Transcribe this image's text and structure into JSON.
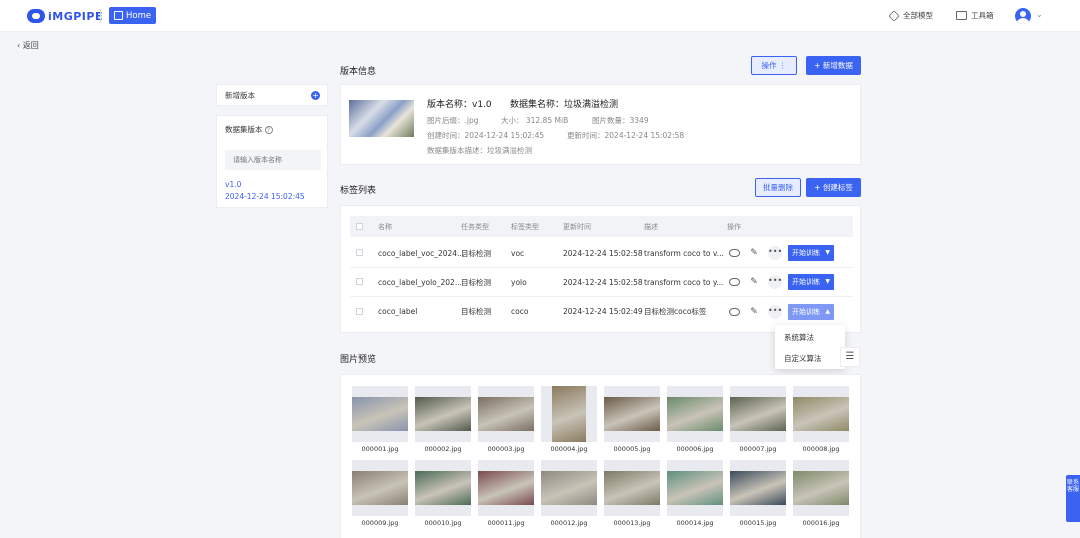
{
  "topbar": {
    "logo_text": "iMGPIPE",
    "home_label": "Home",
    "models_label": "全部模型",
    "toolbox_label": "工具箱"
  },
  "back_label": "返回",
  "sidebar": {
    "new_version_label": "新增版本",
    "versions_title": "数据集版本",
    "search_placeholder": "请输入版本名称",
    "versions": [
      {
        "name": "v1.0",
        "time": "2024-12-24 15:02:45"
      }
    ]
  },
  "version_info": {
    "section_title": "版本信息",
    "operate_label": "操作 ⋮",
    "add_data_label": "+ 新增数据",
    "version_name": "版本名称：v1.0",
    "dataset_name": "数据集名称：垃圾满溢检测",
    "image_ext": "图片后缀：.jpg",
    "size": "大小：  312.85 MiB",
    "image_count": "图片数量：3349",
    "created": "创建时间：2024-12-24 15:02:45",
    "updated": "更新时间：2024-12-24 15:02:58",
    "description": "数据集版本描述：垃圾满溢检测"
  },
  "labels": {
    "section_title": "标签列表",
    "batch_delete_label": "批量删除",
    "create_label": "+ 创建标签",
    "headers": [
      "名称",
      "任务类型",
      "标签类型",
      "更新时间",
      "描述",
      "操作"
    ],
    "rows": [
      {
        "name": "coco_label_voc_2024...",
        "task": "目标检测",
        "type": "voc",
        "time": "2024-12-24 15:02:58",
        "desc": "transform coco to v...",
        "train": "开始训练"
      },
      {
        "name": "coco_label_yolo_202...",
        "task": "目标检测",
        "type": "yolo",
        "time": "2024-12-24 15:02:58",
        "desc": "transform coco to y...",
        "train": "开始训练"
      },
      {
        "name": "coco_label",
        "task": "目标检测",
        "type": "coco",
        "time": "2024-12-24 15:02:49",
        "desc": "目标检测coco标签",
        "train": "开始训练"
      }
    ],
    "dropdown": [
      "系统算法",
      "自定义算法"
    ]
  },
  "gallery": {
    "section_title": "图片预览",
    "images": [
      {
        "name": "000001.jpg",
        "color": "#8893ab",
        "tall": false
      },
      {
        "name": "000002.jpg",
        "color": "#4f5a4c",
        "tall": false
      },
      {
        "name": "000003.jpg",
        "color": "#7a6e62",
        "tall": false
      },
      {
        "name": "000004.jpg",
        "color": "#8a7a5e",
        "tall": true
      },
      {
        "name": "000005.jpg",
        "color": "#6b5a48",
        "tall": false
      },
      {
        "name": "000006.jpg",
        "color": "#6a8a6a",
        "tall": false
      },
      {
        "name": "000007.jpg",
        "color": "#5a6452",
        "tall": false
      },
      {
        "name": "000008.jpg",
        "color": "#8f8a66",
        "tall": false
      },
      {
        "name": "000009.jpg",
        "color": "#8a7e72",
        "tall": false
      },
      {
        "name": "000010.jpg",
        "color": "#4d6a58",
        "tall": false
      },
      {
        "name": "000011.jpg",
        "color": "#7a4a50",
        "tall": false
      },
      {
        "name": "000012.jpg",
        "color": "#8e8a80",
        "tall": false
      },
      {
        "name": "000013.jpg",
        "color": "#7b7a66",
        "tall": false
      },
      {
        "name": "000014.jpg",
        "color": "#5f8f7e",
        "tall": false
      },
      {
        "name": "000015.jpg",
        "color": "#3a4a5a",
        "tall": false
      },
      {
        "name": "000016.jpg",
        "color": "#7c8a6a",
        "tall": false
      }
    ]
  },
  "float_button_label": "联系客服",
  "colors": {
    "primary": "#3a63f2",
    "background": "#f4f5f8"
  }
}
